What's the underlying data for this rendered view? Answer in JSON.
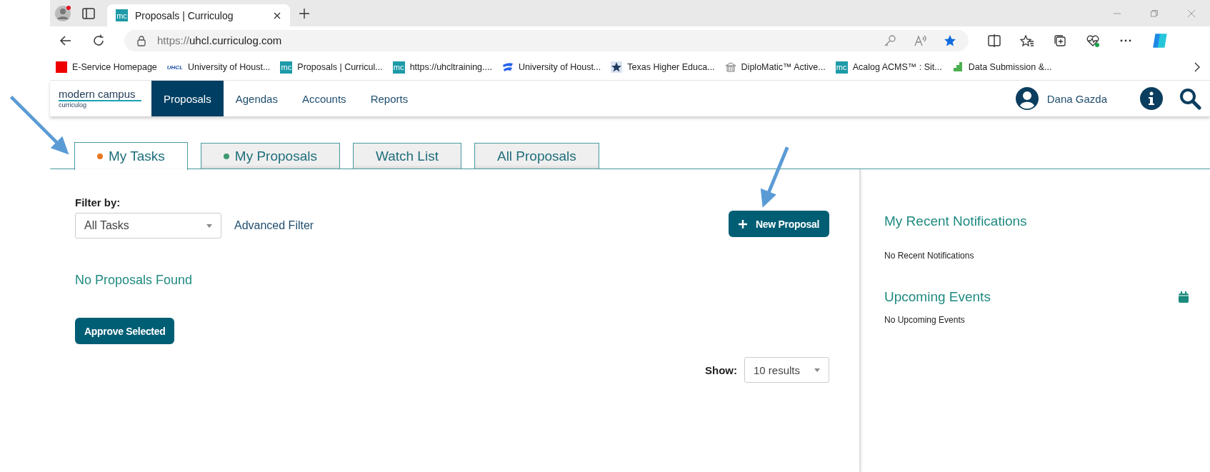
{
  "browser": {
    "tab": {
      "favicon_text": "mc",
      "title": "Proposals | Curriculog"
    },
    "address": {
      "scheme": "https://",
      "host": "uhcl.curriculog.com"
    },
    "bookmarks": [
      {
        "kind": "oracle",
        "label": "E-Service Homepage"
      },
      {
        "kind": "uhcl",
        "icon_text": "UHCL",
        "label": "University of Houst..."
      },
      {
        "kind": "mc",
        "icon_text": "mc",
        "label": "Proposals | Curricul..."
      },
      {
        "kind": "mc",
        "icon_text": "mc",
        "label": "https://uhcltraining...."
      },
      {
        "kind": "wave",
        "label": "University of Houst..."
      },
      {
        "kind": "star",
        "label": "Texas Higher Educa..."
      },
      {
        "kind": "building",
        "label": "DiploMatic™ Active..."
      },
      {
        "kind": "mc",
        "icon_text": "mc",
        "label": "Acalog ACMS™ : Sit..."
      },
      {
        "kind": "steps",
        "label": "Data Submission &..."
      }
    ]
  },
  "header": {
    "logo": {
      "top": "modern campus",
      "bottom": "curriculog"
    },
    "nav": [
      {
        "label": "Proposals",
        "selected": true
      },
      {
        "label": "Agendas",
        "selected": false
      },
      {
        "label": "Accounts",
        "selected": false
      },
      {
        "label": "Reports",
        "selected": false
      }
    ],
    "user": "Dana Gazda"
  },
  "tabs": [
    {
      "label": "My Tasks",
      "selected": true,
      "color": "#e87722"
    },
    {
      "label": "My Proposals",
      "selected": false,
      "color": "#3d9970"
    },
    {
      "label": "Watch List",
      "selected": false
    },
    {
      "label": "All Proposals",
      "selected": false
    }
  ],
  "filter": {
    "label": "Filter by:",
    "value": "All Tasks",
    "advanced": "Advanced Filter"
  },
  "new_proposal": "New Proposal",
  "empty_message": "No Proposals Found",
  "approve": "Approve Selected",
  "show": {
    "label": "Show:",
    "value": "10 results"
  },
  "sidebar": [
    {
      "title": "My Recent Notifications",
      "text": "No Recent Notifications",
      "calendar": false
    },
    {
      "title": "Upcoming Events",
      "text": "No Upcoming Events",
      "calendar": true
    }
  ]
}
